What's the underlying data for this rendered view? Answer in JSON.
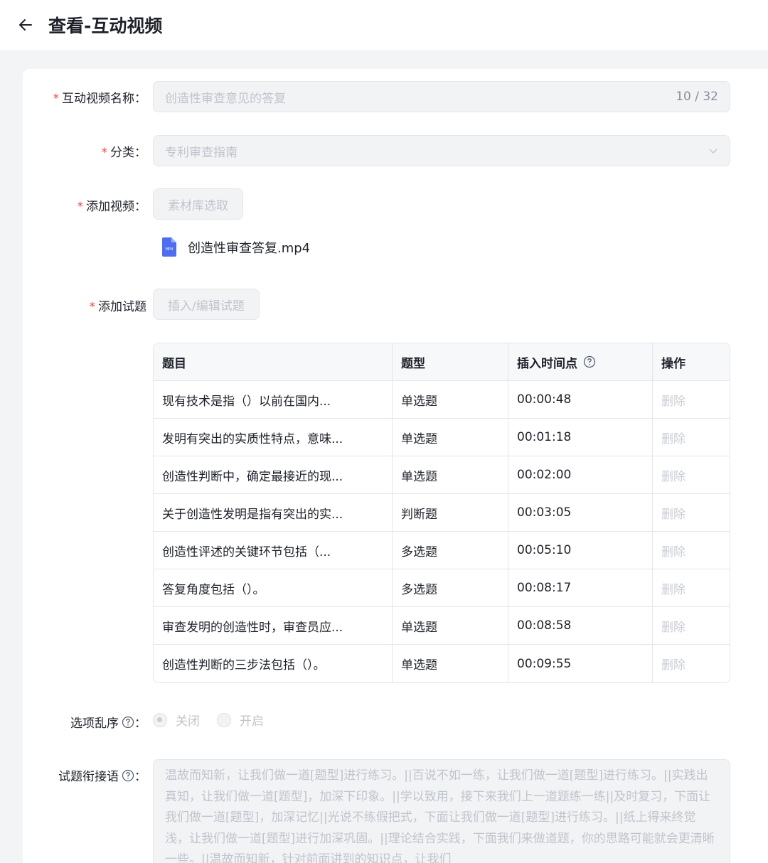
{
  "header": {
    "title": "查看-互动视频"
  },
  "form": {
    "name": {
      "label": "互动视频名称",
      "value": "创造性审查意见的答复",
      "count": "10 / 32"
    },
    "category": {
      "label": "分类",
      "value": "专利审查指南"
    },
    "video": {
      "label": "添加视频",
      "button": "素材库选取",
      "file": "创造性审查答复.mp4",
      "file_badge": "MP4"
    },
    "questions": {
      "label": "添加试题",
      "button": "插入/编辑试题"
    },
    "table": {
      "headers": [
        "题目",
        "题型",
        "插入时间点",
        "操作"
      ],
      "rows": [
        {
          "title": "现有技术是指（）以前在国内...",
          "type": "单选题",
          "time": "00:00:48",
          "action": "删除"
        },
        {
          "title": "发明有突出的实质性特点，意味...",
          "type": "单选题",
          "time": "00:01:18",
          "action": "删除"
        },
        {
          "title": "创造性判断中，确定最接近的现...",
          "type": "单选题",
          "time": "00:02:00",
          "action": "删除"
        },
        {
          "title": "关于创造性发明是指有突出的实...",
          "type": "判断题",
          "time": "00:03:05",
          "action": "删除"
        },
        {
          "title": "创造性评述的关键环节包括（...",
          "type": "多选题",
          "time": "00:05:10",
          "action": "删除"
        },
        {
          "title": "答复角度包括（）。",
          "type": "多选题",
          "time": "00:08:17",
          "action": "删除"
        },
        {
          "title": "审查发明的创造性时，审查员应...",
          "type": "单选题",
          "time": "00:08:58",
          "action": "删除"
        },
        {
          "title": "创造性判断的三步法包括（）。",
          "type": "单选题",
          "time": "00:09:55",
          "action": "删除"
        }
      ]
    },
    "shuffle": {
      "label": "选项乱序",
      "off": "关闭",
      "on": "开启",
      "selected": "关闭"
    },
    "transition": {
      "label": "试题衔接语",
      "text": "温故而知新，让我们做一道[题型]进行练习。||百说不如一练，让我们做一道[题型]进行练习。||实践出真知，让我们做一道[题型]，加深下印象。||学以致用，接下来我们上一道题练一练||及时复习，下面让我们做一道[题型]，加深记忆||光说不练假把式，下面让我们做一道[题型]进行练习。||纸上得来终觉浅，让我们做一道[题型]进行加深巩固。||理论结合实践，下面我们来做道题，你的思路可能就会更清晰一些。||温故而知新，针对前面讲到的知识点，让我们"
    }
  }
}
